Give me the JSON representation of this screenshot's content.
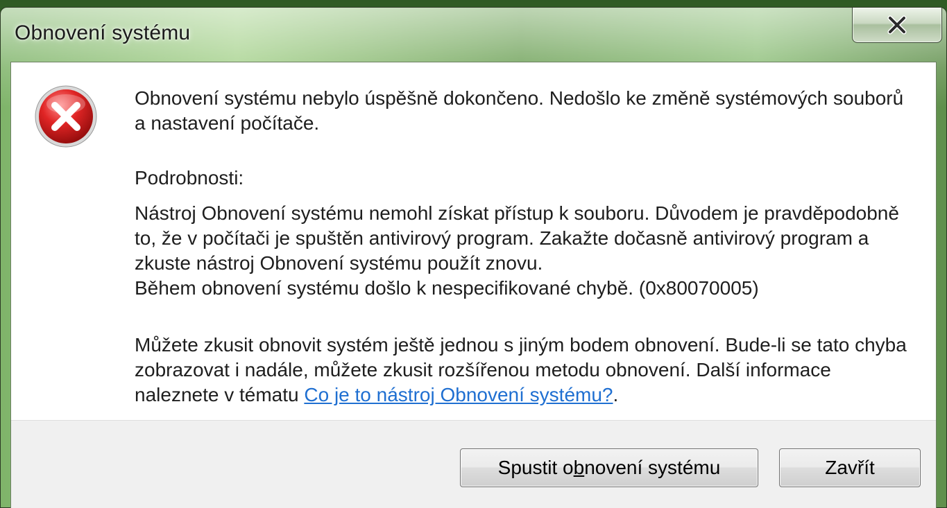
{
  "window": {
    "title": "Obnovení systému",
    "close_icon": "close-x-icon"
  },
  "message": {
    "icon": "error-icon",
    "main_instruction": "Obnovení systému nebylo úspěšně dokončeno. Nedošlo ke změně systémových souborů a nastavení počítače.",
    "details_label": "Podrobnosti:",
    "details_line1": "Nástroj Obnovení systému nemohl získat přístup k souboru. Důvodem je pravděpodobně to, že v počítači je spuštěn antivirový program. Zakažte dočasně antivirový program a zkuste nástroj Obnovení systému použít znovu.",
    "details_line2": "Během obnovení systému došlo k nespecifikované chybě. (0x80070005)",
    "more_text_before_link": "Můžete zkusit obnovit systém ještě jednou s jiným bodem obnovení. Bude-li se tato chyba zobrazovat i nadále, můžete zkusit rozšířenou metodu obnovení. Další informace naleznete v tématu ",
    "help_link": "Co je to nástroj Obnovení systému?",
    "more_text_after_link": "."
  },
  "buttons": {
    "restore_before": "Spustit o",
    "restore_accel": "b",
    "restore_after": "novení systému",
    "close_label": "Zavřít"
  },
  "colors": {
    "link": "#1f6fd1",
    "error_red": "#d42020"
  }
}
